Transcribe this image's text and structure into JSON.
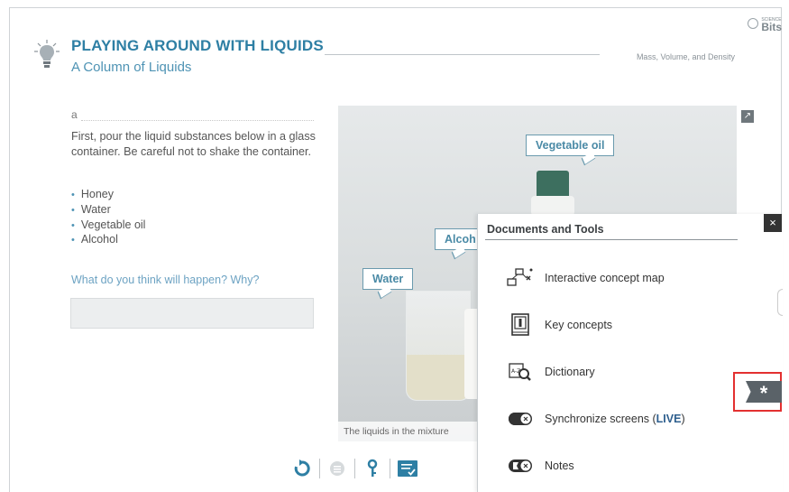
{
  "header": {
    "title": "PLAYING AROUND WITH LIQUIDS",
    "subtitle": "A Column of Liquids",
    "chapter": "Mass, Volume, and Density",
    "brand_small": "SCIENCE",
    "brand_big": "Bits"
  },
  "activity": {
    "letter": "a",
    "instructions": "First, pour the liquid substances below in a glass container. Be careful not to shake the container.",
    "liquids": [
      "Honey",
      "Water",
      "Vegetable oil",
      "Alcohol"
    ],
    "question": "What do you think will happen? Why?",
    "answer_value": ""
  },
  "image": {
    "labels": {
      "vegetable_oil": "Vegetable oil",
      "alcohol": "Alcoh",
      "water": "Water"
    },
    "caption": "The liquids in the mixture"
  },
  "panel": {
    "title": "Documents and Tools",
    "close": "×",
    "tools": [
      {
        "label": "Interactive concept map",
        "icon": "concept-map-icon"
      },
      {
        "label": "Key concepts",
        "icon": "key-concepts-icon"
      },
      {
        "label": "Dictionary",
        "icon": "dictionary-icon"
      },
      {
        "label": "Synchronize screens (",
        "label_strong": "LIVE",
        "label_end": ")",
        "icon": "toggle-icon"
      },
      {
        "label": "Notes",
        "icon": "notes-icon"
      }
    ]
  },
  "colors": {
    "accent": "#2e7fa4",
    "highlight": "#e33030",
    "panel_close_bg": "#333333"
  }
}
